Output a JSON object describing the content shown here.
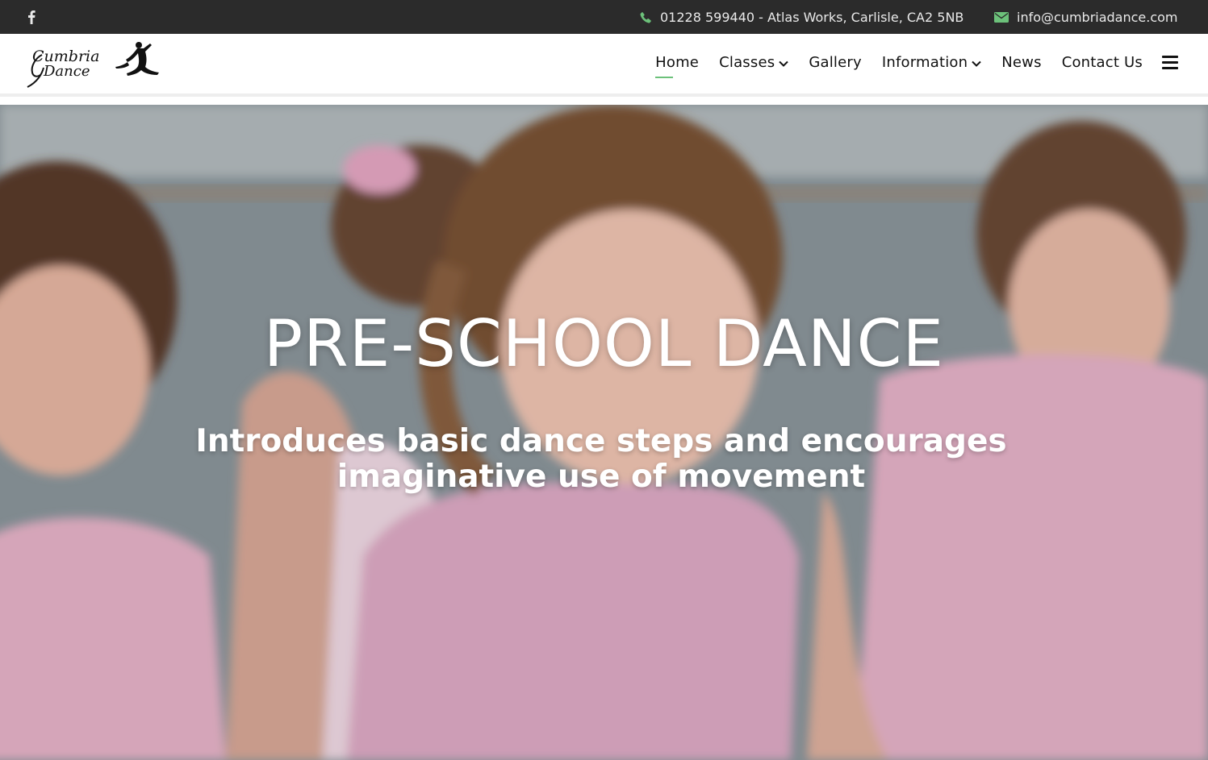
{
  "topbar": {
    "contact_line": "01228 599440 - Atlas Works, Carlisle, CA2 5NB",
    "email": "info@cumbriadance.com",
    "icon_color": "#6cc17a"
  },
  "logo": {
    "line1": "Cumbria",
    "line2": "Dance"
  },
  "nav": {
    "items": [
      {
        "label": "Home",
        "active": true
      },
      {
        "label": "Classes",
        "dropdown": true
      },
      {
        "label": "Gallery"
      },
      {
        "label": "Information",
        "dropdown": true
      },
      {
        "label": "News"
      },
      {
        "label": "Contact Us"
      }
    ],
    "accent": "#6cc17a"
  },
  "hero": {
    "title": "PRE-SCHOOL DANCE",
    "subtitle": "Introduces basic dance steps and encourages imaginative use of movement"
  }
}
